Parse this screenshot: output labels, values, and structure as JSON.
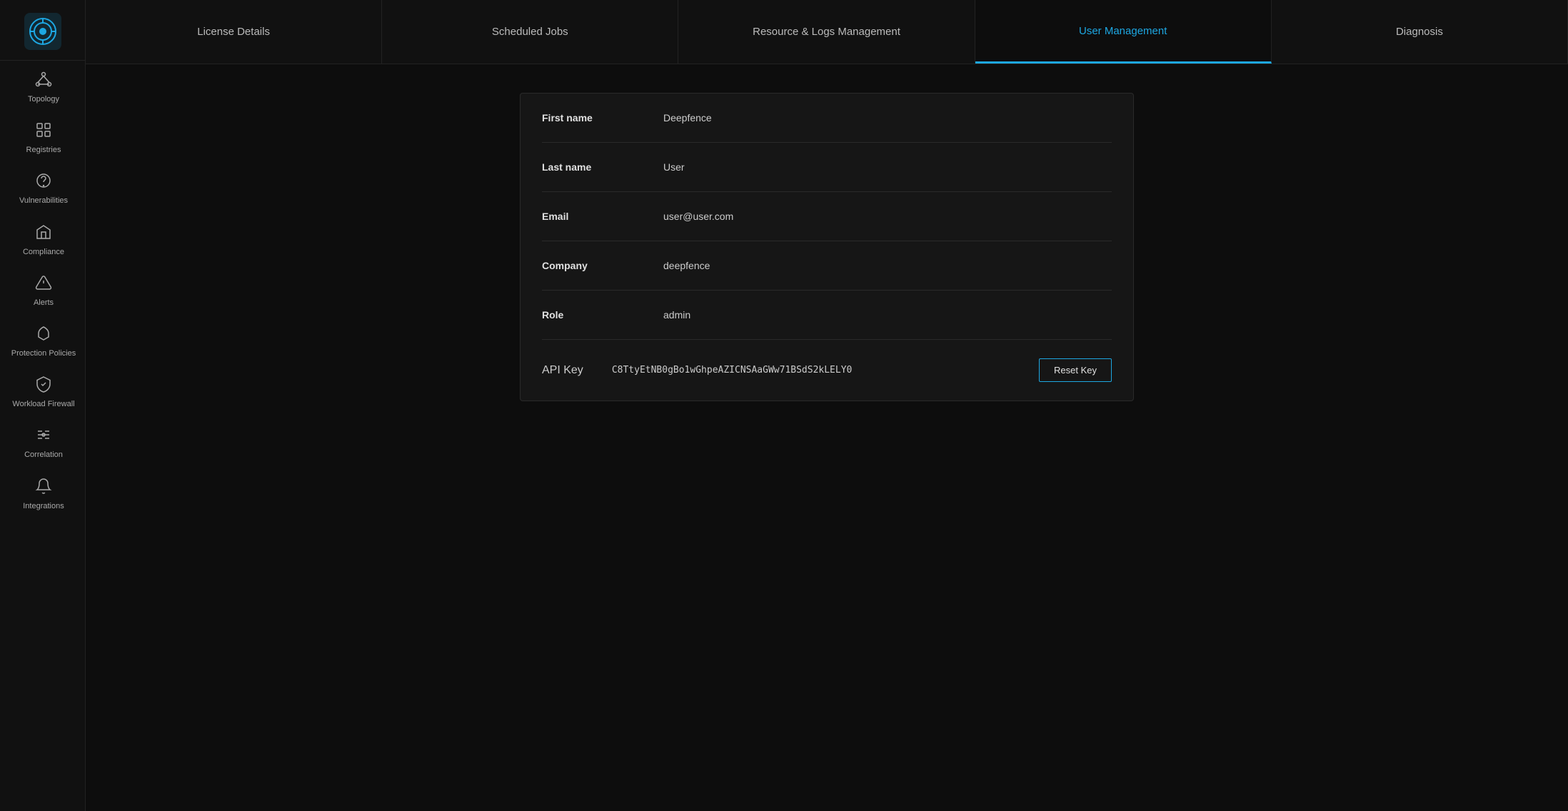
{
  "brand": {
    "name": "deepfence"
  },
  "sidebar": {
    "items": [
      {
        "id": "topology",
        "label": "Topology",
        "icon": "❊",
        "active": false
      },
      {
        "id": "registries",
        "label": "Registries",
        "icon": "▦",
        "active": false
      },
      {
        "id": "vulnerabilities",
        "label": "Vulnerabilities",
        "icon": "☣",
        "active": false
      },
      {
        "id": "compliance",
        "label": "Compliance",
        "icon": "⛪",
        "active": false
      },
      {
        "id": "alerts",
        "label": "Alerts",
        "icon": "⚠",
        "active": false
      },
      {
        "id": "protection-policies",
        "label": "Protection Policies",
        "icon": "☂",
        "active": false
      },
      {
        "id": "workload-firewall",
        "label": "Workload Firewall",
        "icon": "⛨",
        "active": false
      },
      {
        "id": "correlation",
        "label": "Correlation",
        "icon": "⇌",
        "active": false
      },
      {
        "id": "integrations",
        "label": "Integrations",
        "icon": "🔔",
        "active": false
      }
    ]
  },
  "tabs": [
    {
      "id": "license-details",
      "label": "License Details",
      "active": false
    },
    {
      "id": "scheduled-jobs",
      "label": "Scheduled Jobs",
      "active": false
    },
    {
      "id": "resource-logs",
      "label": "Resource & Logs Management",
      "active": false
    },
    {
      "id": "user-management",
      "label": "User Management",
      "active": true
    },
    {
      "id": "diagnosis",
      "label": "Diagnosis",
      "active": false
    }
  ],
  "user": {
    "first_name_label": "First name",
    "first_name_value": "Deepfence",
    "last_name_label": "Last name",
    "last_name_value": "User",
    "email_label": "Email",
    "email_value": "user@user.com",
    "company_label": "Company",
    "company_value": "deepfence",
    "role_label": "Role",
    "role_value": "admin",
    "api_key_label": "API Key",
    "api_key_value": "C8TtyEtNB0gBo1wGhpeAZICNSAaGWw71BSdS2kLELY0",
    "reset_key_label": "Reset Key"
  },
  "colors": {
    "accent": "#1da7e2",
    "bg_dark": "#0d0d0d",
    "sidebar_bg": "#111",
    "card_bg": "#161616"
  }
}
